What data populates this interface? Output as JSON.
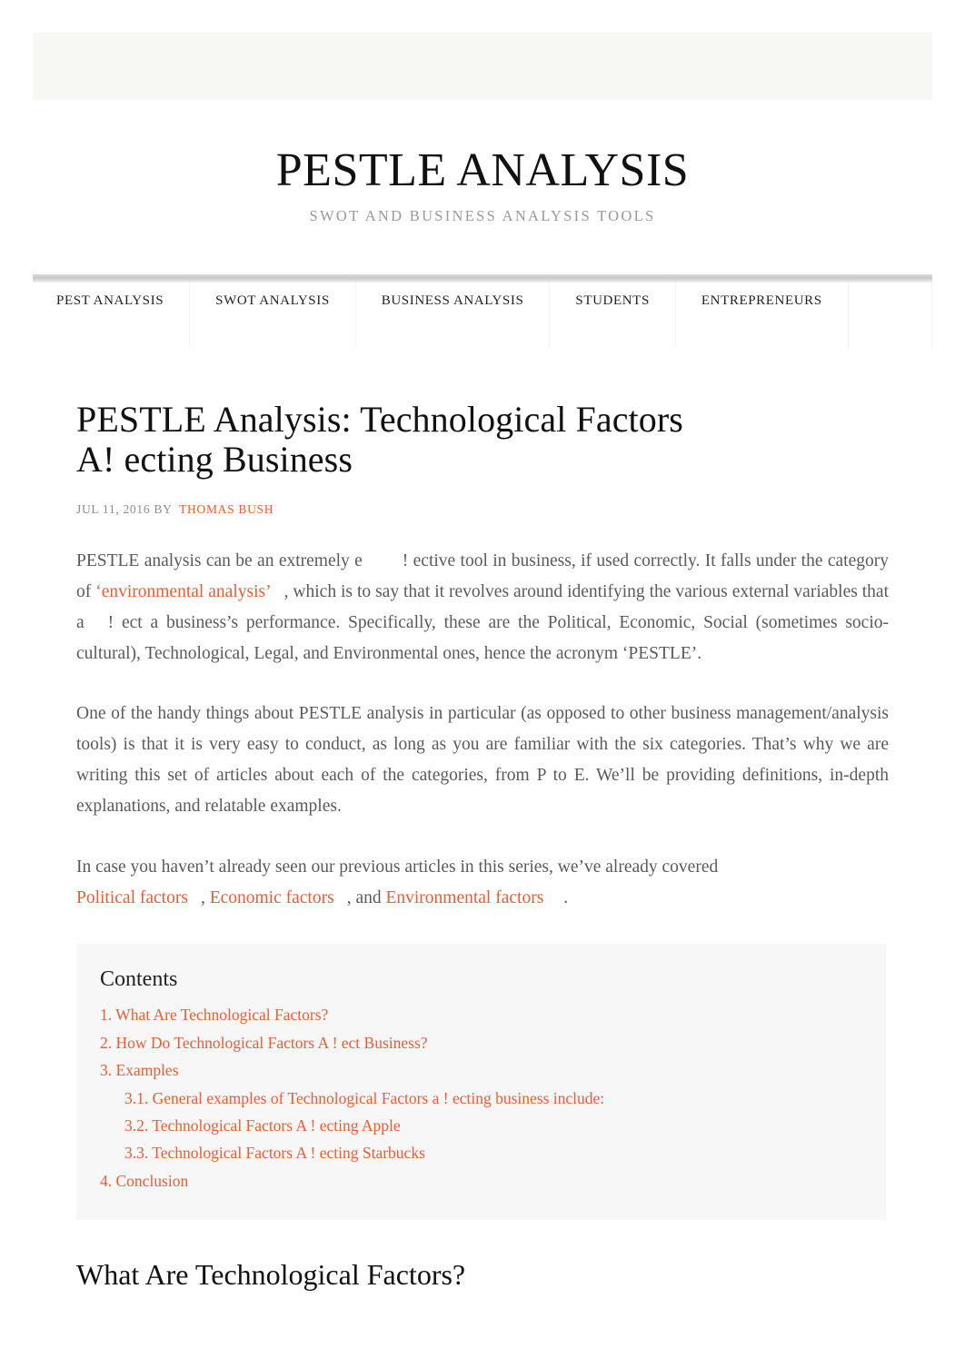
{
  "colors": {
    "accent": "#ef5b33",
    "body_text": "#5a5a5a",
    "heading": "#111111",
    "meta": "#8c8c8c",
    "toc_background": "#f7f7f7",
    "banner_background": "#f7f7f3",
    "nav_bar": "#c9c9c9"
  },
  "header": {
    "title": "PESTLE ANALYSIS",
    "tagline": "SWOT AND BUSINESS ANALYSIS TOOLS"
  },
  "nav": {
    "items": [
      {
        "label": "PEST ANALYSIS"
      },
      {
        "label": "SWOT ANALYSIS"
      },
      {
        "label": "BUSINESS ANALYSIS"
      },
      {
        "label": "STUDENTS"
      },
      {
        "label": "ENTREPRENEURS"
      }
    ]
  },
  "article": {
    "title": "PESTLE Analysis: Technological Factors A! ecting Business",
    "title_line1": "PESTLE Analysis: Technological Factors",
    "title_line2": "A! ecting Business",
    "meta": {
      "date": "JUL 11, 2016",
      "by": "BY",
      "author": "THOMAS BUSH"
    },
    "paragraph1": {
      "part1": "PESTLE analysis can be an extremely e",
      "part2": "! ective tool in business, if used correctly. It falls under the category of",
      "link": "‘environmental analysis’",
      "part3": ", which is to say that it revolves around identifying the various external variables that a",
      "part4": "! ect a business’s performance. Specifically, these are the Political, Economic, Social (sometimes socio-cultural), Technological, Legal, and Environmental ones, hence the acronym ‘PESTLE’."
    },
    "paragraph2": "One of the handy things about PESTLE analysis in particular (as opposed to other business management/analysis tools) is that it is very easy to conduct, as long as you are familiar with the six categories. That’s why we are writing this set of articles about each of the categories, from P to E. We’ll be providing definitions, in-depth explanations, and relatable examples.",
    "paragraph3": {
      "part1": "In case you haven’t already seen our previous articles in this series, we’ve already covered",
      "link1": "Political factors",
      "sep1": ",",
      "link2": "Economic factors",
      "sep2": ", and",
      "link3": "Environmental factors",
      "end": "."
    }
  },
  "toc": {
    "title": "Contents",
    "items": [
      {
        "label": "1. What Are Technological Factors?",
        "level": 1
      },
      {
        "label": "2. How Do Technological Factors A     ! ect Business?",
        "level": 1
      },
      {
        "label": "3. Examples",
        "level": 1
      },
      {
        "label": "3.1. General examples of Technological Factors a          ! ecting business include:",
        "level": 2
      },
      {
        "label": "3.2. Technological Factors A     ! ecting Apple",
        "level": 2
      },
      {
        "label": "3.3. Technological Factors A     ! ecting Starbucks",
        "level": 2
      },
      {
        "label": "4. Conclusion",
        "level": 1
      }
    ]
  },
  "section_heading": "What Are Technological Factors?"
}
